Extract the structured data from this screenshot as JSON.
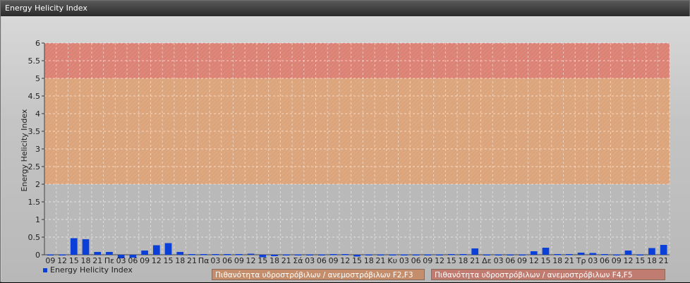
{
  "window": {
    "title": "Energy Helicity Index"
  },
  "legend": {
    "series_label": "Energy Helicity Index"
  },
  "bands": [
    {
      "label": "Πιθανότητα υδροστρόβιλων / ανεμοστρόβιλων F2,F3",
      "from": 2,
      "to": 5,
      "color": "#e0a070"
    },
    {
      "label": "Πιθανότητα υδροστρόβιλων / ανεμοστρόβιλων F4,F5",
      "from": 5,
      "to": 6,
      "color": "#e07868"
    }
  ],
  "colors": {
    "bar": "#0a3fd8",
    "grid": "#ffffff",
    "axis_text": "#222222"
  },
  "chart_data": {
    "type": "bar",
    "ylabel": "Energy Helicity Index",
    "ylim": [
      0,
      6
    ],
    "yticks": [
      0,
      0.5,
      1,
      1.5,
      2,
      2.5,
      3,
      3.5,
      4,
      4.5,
      5,
      5.5,
      6
    ],
    "grid": true,
    "categories": [
      "09",
      "12",
      "15",
      "18",
      "21",
      "Πε",
      "03",
      "06",
      "09",
      "12",
      "15",
      "18",
      "21",
      "Πα",
      "03",
      "06",
      "09",
      "12",
      "15",
      "18",
      "21",
      "Σά",
      "03",
      "06",
      "09",
      "12",
      "15",
      "18",
      "21",
      "Κυ",
      "03",
      "06",
      "09",
      "12",
      "15",
      "18",
      "21",
      "Δε",
      "03",
      "06",
      "09",
      "12",
      "15",
      "18",
      "21",
      "Τρ",
      "03",
      "06",
      "09",
      "12",
      "15",
      "18",
      "21"
    ],
    "series": [
      {
        "values": [
          0.01,
          0.01,
          0.47,
          0.44,
          0.08,
          0.08,
          -0.1,
          -0.08,
          0.12,
          0.27,
          0.33,
          0.08,
          0.02,
          0.02,
          0.02,
          0.02,
          0.02,
          0.03,
          -0.07,
          -0.04,
          0.01,
          0.01,
          0.01,
          0.01,
          0.02,
          0.02,
          -0.05,
          0.01,
          0.01,
          0.01,
          0.01,
          0.01,
          0.01,
          0.01,
          0.02,
          0.02,
          0.18,
          0.01,
          0.01,
          0.01,
          0.01,
          0.1,
          0.2,
          0.02,
          0.02,
          0.06,
          0.05,
          0.02,
          0.01,
          0.12,
          0.01,
          0.19,
          0.28
        ]
      }
    ]
  }
}
